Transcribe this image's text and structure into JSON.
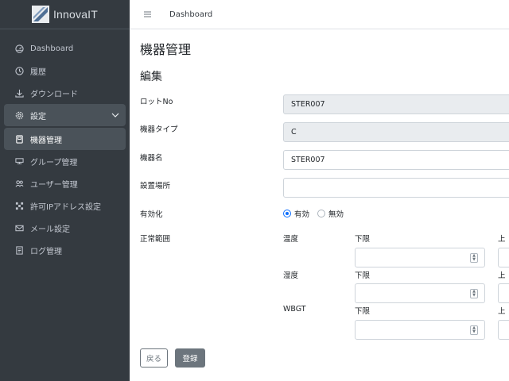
{
  "brand": {
    "name": "InnovaIT"
  },
  "topbar": {
    "title": "Dashboard"
  },
  "sidebar": {
    "items": [
      {
        "label": "Dashboard",
        "icon": "gauge-icon"
      },
      {
        "label": "履歴",
        "icon": "history-icon"
      },
      {
        "label": "ダウンロード",
        "icon": "download-icon"
      },
      {
        "label": "設定",
        "icon": "gear-icon"
      },
      {
        "label": "機器管理",
        "icon": "device-icon"
      },
      {
        "label": "グループ管理",
        "icon": "group-icon"
      },
      {
        "label": "ユーザー管理",
        "icon": "users-icon"
      },
      {
        "label": "許可IPアドレス設定",
        "icon": "network-icon"
      },
      {
        "label": "メール設定",
        "icon": "mail-icon"
      },
      {
        "label": "ログ管理",
        "icon": "log-icon"
      }
    ]
  },
  "page": {
    "title": "機器管理",
    "section": "編集"
  },
  "form": {
    "lot_label": "ロットNo",
    "lot_value": "STER007",
    "type_label": "機器タイプ",
    "type_value": "C",
    "name_label": "機器名",
    "name_value": "STER007",
    "location_label": "設置場所",
    "location_value": "",
    "enabled_label": "有効化",
    "enabled_on": "有効",
    "enabled_off": "無効",
    "range_label": "正常範囲",
    "ranges": [
      {
        "name": "温度",
        "lower": "下限",
        "upper": "上"
      },
      {
        "name": "湿度",
        "lower": "下限",
        "upper": "上"
      },
      {
        "name": "WBGT",
        "lower": "下限",
        "upper": "上"
      }
    ],
    "back_label": "戻る",
    "save_label": "登録"
  },
  "colors": {
    "sidebar": "#343a40",
    "primary": "#0d6efd",
    "secondary": "#6c757d"
  }
}
